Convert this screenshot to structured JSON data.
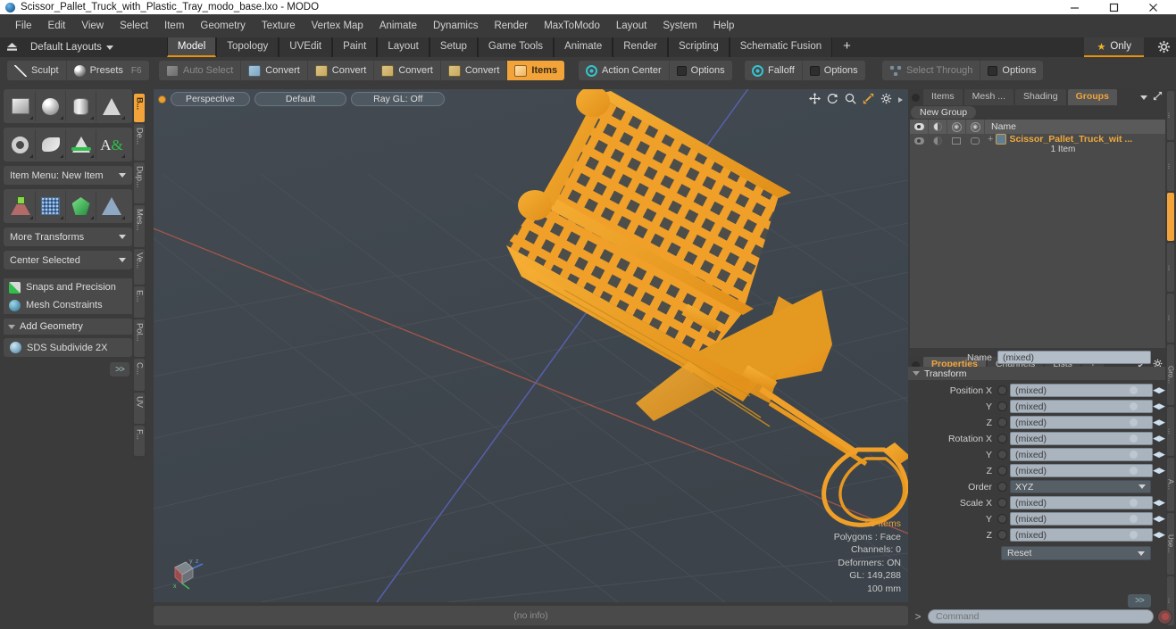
{
  "window": {
    "title": "Scissor_Pallet_Truck_with_Plastic_Tray_modo_base.lxo - MODO",
    "app_icon": "modo-sphere-icon",
    "minimize": "minimize-icon",
    "maximize": "maximize-icon",
    "close": "close-icon"
  },
  "menubar": {
    "items": [
      "File",
      "Edit",
      "View",
      "Select",
      "Item",
      "Geometry",
      "Texture",
      "Vertex Map",
      "Animate",
      "Dynamics",
      "Render",
      "MaxToModo",
      "Layout",
      "System",
      "Help"
    ]
  },
  "layoutbar": {
    "home_icon": "home-icon",
    "layouts_label": "Default Layouts",
    "tabs": [
      {
        "label": "Model",
        "active": true
      },
      {
        "label": "Topology",
        "active": false
      },
      {
        "label": "UVEdit",
        "active": false
      },
      {
        "label": "Paint",
        "active": false
      },
      {
        "label": "Layout",
        "active": false
      },
      {
        "label": "Setup",
        "active": false
      },
      {
        "label": "Game Tools",
        "active": false
      },
      {
        "label": "Animate",
        "active": false
      },
      {
        "label": "Render",
        "active": false
      },
      {
        "label": "Scripting",
        "active": false
      },
      {
        "label": "Schematic Fusion",
        "active": false
      }
    ],
    "add_tab": "+",
    "only_label": "Only",
    "only_star": "star-icon",
    "settings_icon": "gear-icon"
  },
  "toolbar": {
    "group1": [
      {
        "label": "Sculpt",
        "icon": "sculpt-brush-icon",
        "state": "normal",
        "shortcut": ""
      },
      {
        "label": "Presets",
        "icon": "presets-sphere-icon",
        "state": "normal",
        "shortcut": "F6"
      }
    ],
    "group2": [
      {
        "label": "Auto Select",
        "icon": "auto-select-icon",
        "state": "dim"
      },
      {
        "label": "Convert",
        "icon": "convert-vertex-icon",
        "state": "normal"
      },
      {
        "label": "Convert",
        "icon": "convert-edge-icon",
        "state": "normal"
      },
      {
        "label": "Convert",
        "icon": "convert-poly-icon",
        "state": "normal"
      },
      {
        "label": "Convert",
        "icon": "convert-material-icon",
        "state": "normal"
      },
      {
        "label": "Items",
        "icon": "items-cube-icon",
        "state": "active"
      }
    ],
    "group3": [
      {
        "label": "Action Center",
        "icon": "action-center-icon",
        "state": "normal"
      },
      {
        "label": "Options",
        "icon": "checkbox-icon",
        "state": "normal"
      }
    ],
    "group4": [
      {
        "label": "Falloff",
        "icon": "falloff-icon",
        "state": "normal"
      },
      {
        "label": "Options",
        "icon": "checkbox-icon",
        "state": "normal"
      }
    ],
    "group5": [
      {
        "label": "Select Through",
        "icon": "select-through-icon",
        "state": "dim"
      },
      {
        "label": "Options",
        "icon": "checkbox-icon",
        "state": "normal"
      }
    ]
  },
  "left_panel": {
    "primitive_row1": [
      {
        "name": "cube-primitive",
        "icon": "cube-icon"
      },
      {
        "name": "sphere-primitive",
        "icon": "sphere-icon"
      },
      {
        "name": "cylinder-primitive",
        "icon": "cylinder-icon"
      },
      {
        "name": "cone-primitive",
        "icon": "cone-icon"
      }
    ],
    "primitive_row2": [
      {
        "name": "torus-primitive",
        "icon": "torus-icon"
      },
      {
        "name": "curve-primitive",
        "icon": "curve-icon"
      },
      {
        "name": "bezier-primitive",
        "icon": "bezier-icon"
      },
      {
        "name": "text-primitive",
        "icon": "text-icon"
      }
    ],
    "item_menu_label": "Item Menu: New Item",
    "transform_row": [
      {
        "name": "transform-tool",
        "icon": "transform-axis-icon"
      },
      {
        "name": "mesh-grid-tool",
        "icon": "mesh-grid-icon"
      },
      {
        "name": "gem-tool",
        "icon": "gem-icon"
      },
      {
        "name": "pyramid-tool",
        "icon": "pyramid-icon"
      }
    ],
    "more_transforms_label": "More Transforms",
    "center_selected_label": "Center Selected",
    "snaps_label": "Snaps and Precision",
    "mesh_constraints_label": "Mesh Constraints",
    "add_geometry_label": "Add Geometry",
    "sds_label": "SDS Subdivide 2X",
    "advanced_label": ">>",
    "vertical_tabs": [
      {
        "label": "B...",
        "active": true
      },
      {
        "label": "De...",
        "active": false
      },
      {
        "label": "Dup...",
        "active": false
      },
      {
        "label": "Mes...",
        "active": false
      },
      {
        "label": "Ve...",
        "active": false
      },
      {
        "label": "E...",
        "active": false
      },
      {
        "label": "Pol...",
        "active": false
      },
      {
        "label": "C...",
        "active": false
      },
      {
        "label": "UV",
        "active": false
      },
      {
        "label": "F...",
        "active": false
      }
    ]
  },
  "viewport": {
    "view_mode": "Perspective",
    "shading_mode": "Default",
    "raygl": "Ray GL: Off",
    "tool_icons": [
      "pan-icon",
      "rotate-icon",
      "zoom-icon",
      "fit-icon",
      "gear-icon",
      "play-icon"
    ],
    "stats": {
      "items": "55 Items",
      "polygons": "Polygons : Face",
      "channels": "Channels: 0",
      "deformers": "Deformers: ON",
      "gl": "GL: 149,288",
      "scale": "100 mm"
    },
    "axis_gizmo": {
      "x": "x",
      "y": "y",
      "z": "z"
    },
    "model_color": "#f0a028",
    "background_color": "#3f464d"
  },
  "right_panel": {
    "top_tabs": [
      {
        "label": "Items",
        "active": false
      },
      {
        "label": "Mesh ...",
        "active": false
      },
      {
        "label": "Shading",
        "active": false
      },
      {
        "label": "Groups",
        "active": true
      }
    ],
    "top_tab_icons": [
      "chevron-down-icon",
      "expand-icon",
      "chevron-right-icon"
    ],
    "new_group_label": "New Group",
    "list_columns": [
      "visibility-col",
      "render-col",
      "lock-col",
      "select-col",
      "Name"
    ],
    "list_rows": [
      {
        "name": "Scissor_Pallet_Truck_wit ...",
        "sub": "1 Item",
        "expander": "+",
        "icon": "group-icon"
      }
    ],
    "properties_tabs": [
      {
        "label": "Properties",
        "active": true
      },
      {
        "label": "Channels",
        "active": false
      },
      {
        "label": "Lists",
        "active": false
      },
      {
        "label": "+",
        "active": false
      }
    ],
    "properties_tab_icons": [
      "expand-icon",
      "gear-icon",
      "chevron-right-icon"
    ],
    "name_label": "Name",
    "name_value": "(mixed)",
    "transform_section": "Transform",
    "fields": [
      {
        "label": "Position X",
        "value": "(mixed)",
        "type": "number"
      },
      {
        "label": "Y",
        "value": "(mixed)",
        "type": "number"
      },
      {
        "label": "Z",
        "value": "(mixed)",
        "type": "number"
      },
      {
        "label": "Rotation X",
        "value": "(mixed)",
        "type": "number"
      },
      {
        "label": "Y",
        "value": "(mixed)",
        "type": "number"
      },
      {
        "label": "Z",
        "value": "(mixed)",
        "type": "number"
      },
      {
        "label": "Order",
        "value": "XYZ",
        "type": "select"
      },
      {
        "label": "Scale X",
        "value": "(mixed)",
        "type": "number"
      },
      {
        "label": "Y",
        "value": "(mixed)",
        "type": "number"
      },
      {
        "label": "Z",
        "value": "(mixed)",
        "type": "number"
      }
    ],
    "reset_label": "Reset",
    "advanced_label": ">>",
    "vertical_tabs": [
      {
        "label": "...",
        "active": false
      },
      {
        "label": "...",
        "active": false
      },
      {
        "label": "...",
        "active": true
      },
      {
        "label": "...",
        "active": false
      },
      {
        "label": "...",
        "active": false
      },
      {
        "label": "Gro...",
        "active": false
      },
      {
        "label": "...",
        "active": false
      },
      {
        "label": "A...",
        "active": false
      },
      {
        "label": "Use...",
        "active": false
      },
      {
        "label": "...",
        "active": false
      }
    ]
  },
  "statusbar": {
    "info": "(no info)"
  },
  "command_bar": {
    "prompt": ">",
    "placeholder": "Command",
    "record_icon": "record-icon"
  }
}
